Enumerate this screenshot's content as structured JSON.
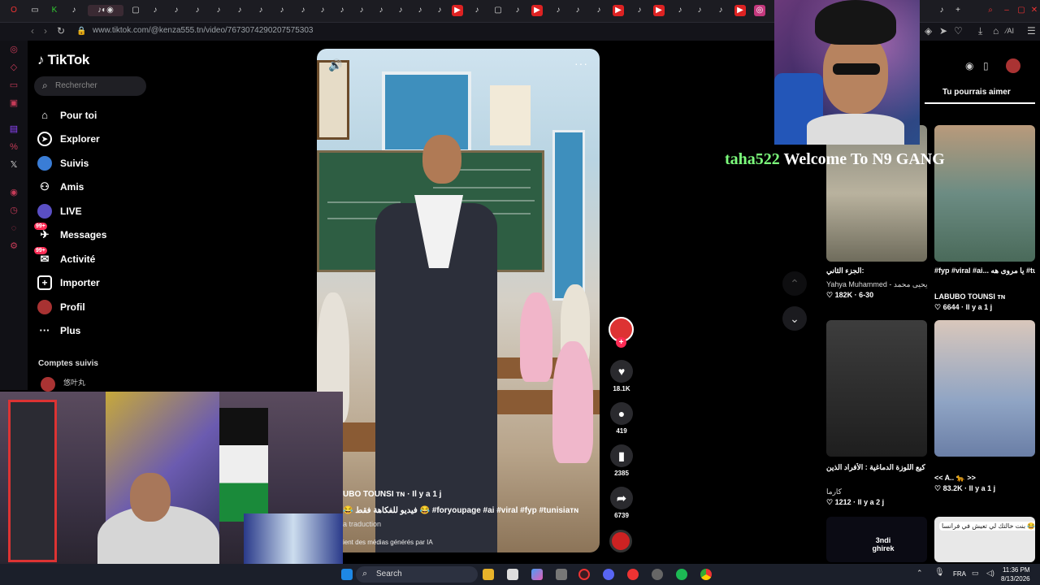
{
  "browser": {
    "url": "www.tiktok.com/@kenza555.tn/video/7673074290207575303"
  },
  "tiktok": {
    "logo": "TikTok",
    "search_placeholder": "Rechercher",
    "nav": [
      {
        "label": "Pour toi",
        "icon": "home-icon"
      },
      {
        "label": "Explorer",
        "icon": "compass-icon"
      },
      {
        "label": "Suivis",
        "icon": "following-icon"
      },
      {
        "label": "Amis",
        "icon": "friends-icon"
      },
      {
        "label": "LIVE",
        "icon": "live-icon"
      },
      {
        "label": "Messages",
        "icon": "messages-icon",
        "badge": "99+"
      },
      {
        "label": "Activité",
        "icon": "activity-icon",
        "badge": "99+"
      },
      {
        "label": "Importer",
        "icon": "upload-icon"
      },
      {
        "label": "Profil",
        "icon": "profile-icon"
      },
      {
        "label": "Plus",
        "icon": "more-icon"
      }
    ],
    "followed_title": "Comptes suivis",
    "followed_user": "悠叶丸"
  },
  "video": {
    "creator": "UBO TOUNSI ᴛɴ · Il y a 1 j",
    "description": "😂 فيديو للفكاهة فقط 😂 #foryoupage #ai #viral #fyp #tunisiaᴛɴ",
    "translation": "a traduction",
    "ai_label": "ient des médias générés par IA",
    "likes": "18.1K",
    "comments": "419",
    "saves": "2385",
    "shares": "6739"
  },
  "suggestions": {
    "title": "Tu pourrais aimer",
    "cards": [
      {
        "caption": "الجزء الثاني:",
        "meta_author": "Yahya Muhammed - يحيى محمد",
        "meta_stats": "♡ 182K · 6-30"
      },
      {
        "caption": "#fyp #viral #ai... يا مروى هه #tunisiaᴛɴ",
        "meta_author": "LABUBO TOUNSI ᴛɴ",
        "meta_stats": "♡ 6644 · Il y a 1 j"
      },
      {
        "caption": "كيع اللوزة الدماغية : الأفراد الذين ...",
        "meta_author": "كارما",
        "meta_stats": "♡ 1212 · Il y a 2 j"
      },
      {
        "caption": "<< A.. 🐆 >>",
        "meta_author": "",
        "meta_stats": "♡ 83.2K · Il y a 1 j"
      },
      {
        "caption": "3ndi ghirek",
        "meta_author": "",
        "meta_stats": ""
      },
      {
        "caption": "بنت خالتك لي تعيش في فرانسا 😂😂😂",
        "meta_author": "",
        "meta_stats": ""
      }
    ]
  },
  "overlay": {
    "username": "taha522",
    "message": "Welcome To N9 GANG"
  },
  "taskbar": {
    "search_placeholder": "Search",
    "lang": "FRA",
    "time": "11:36 PM",
    "date": "8/13/2026"
  },
  "colors": {
    "accent": "#fe2c55",
    "overlay_user": "#7cfc7c",
    "overlay_message": "#ffffff"
  }
}
